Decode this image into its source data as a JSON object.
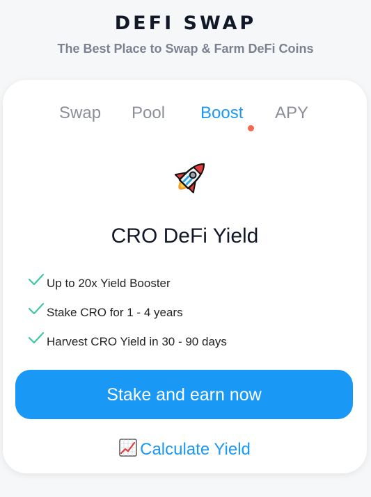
{
  "header": {
    "title": "DEFI SWAP",
    "subtitle": "The Best Place to Swap & Farm DeFi Coins"
  },
  "tabs": [
    {
      "label": "Swap",
      "active": false
    },
    {
      "label": "Pool",
      "active": false
    },
    {
      "label": "Boost",
      "active": true,
      "has_notification": true
    },
    {
      "label": "APY",
      "active": false
    }
  ],
  "card": {
    "icon": "rocket-icon",
    "title": "CRO DeFi Yield",
    "features": [
      {
        "icon": "check-icon",
        "text": "Up to 20x Yield Booster"
      },
      {
        "icon": "check-icon",
        "text": "Stake CRO for 1 - 4 years"
      },
      {
        "icon": "check-icon",
        "text": "Harvest CRO Yield in 30 - 90 days"
      }
    ],
    "cta_label": "Stake and earn now",
    "link_icon": "chart-increasing-icon",
    "link_label": "Calculate Yield"
  },
  "colors": {
    "accent": "#1a98f5",
    "check": "#3ec6a6",
    "notification": "#f2694d",
    "muted_text": "#8b8f97",
    "background": "#f6f7f8"
  }
}
